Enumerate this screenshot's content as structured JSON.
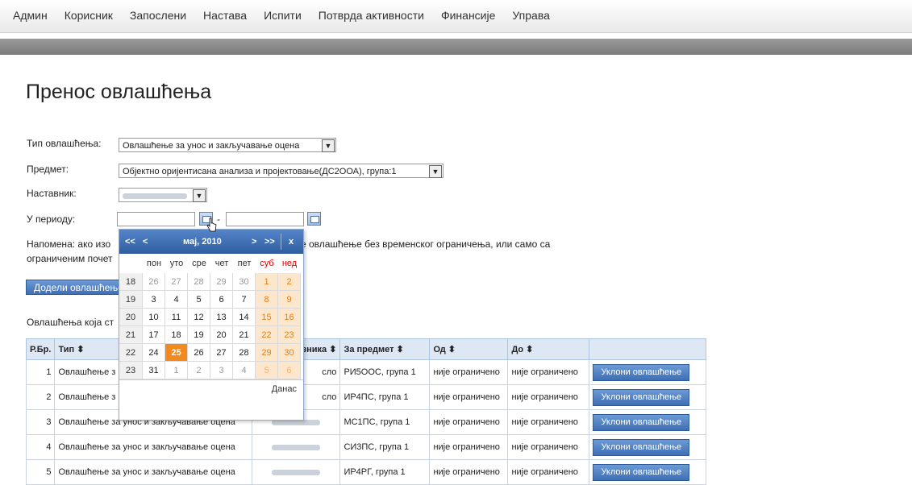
{
  "nav": [
    "Админ",
    "Корисник",
    "Запослени",
    "Настава",
    "Испити",
    "Потврда активности",
    "Финансије",
    "Управа"
  ],
  "page_title": "Пренос овлашћења",
  "form": {
    "type_label": "Тип овлашћења:",
    "type_value": "Овлашћење за унос и закључавање оцена",
    "subject_label": "Предмет:",
    "subject_value": "Објектно оријентисана анализа и пројектовање(ДС2ООА), група:1",
    "teacher_label": "Наставник:",
    "period_label": "У периоду:",
    "period_sep": "-"
  },
  "note": {
    "part1": "Напомена: ако изо",
    "part2": "доделите овлашћење без временског ограничења, или само са",
    "part3": "ограниченим почет"
  },
  "assign_button": "Додели овлашћење",
  "list_title": "Овлашћења која ст",
  "calendar": {
    "prev_year": "<<",
    "prev_month": "<",
    "month_label": "мај, 2010",
    "next_month": ">",
    "next_year": ">>",
    "close": "x",
    "weekdays": [
      "пон",
      "уто",
      "сре",
      "чет",
      "пет",
      "суб",
      "нед"
    ],
    "weeks": [
      {
        "wk": "18",
        "days": [
          "26",
          "27",
          "28",
          "29",
          "30",
          "1",
          "2"
        ]
      },
      {
        "wk": "19",
        "days": [
          "3",
          "4",
          "5",
          "6",
          "7",
          "8",
          "9"
        ]
      },
      {
        "wk": "20",
        "days": [
          "10",
          "11",
          "12",
          "13",
          "14",
          "15",
          "16"
        ]
      },
      {
        "wk": "21",
        "days": [
          "17",
          "18",
          "19",
          "20",
          "21",
          "22",
          "23"
        ]
      },
      {
        "wk": "22",
        "days": [
          "24",
          "25",
          "26",
          "27",
          "28",
          "29",
          "30"
        ]
      },
      {
        "wk": "23",
        "days": [
          "31",
          "1",
          "2",
          "3",
          "4",
          "5",
          "6"
        ]
      }
    ],
    "today_label": "Данас"
  },
  "table": {
    "headers": {
      "no": "Р.Бр.",
      "type": "Тип ⬍",
      "teacher": "зника ⬍",
      "subject": "За предмет ⬍",
      "from": "Од ⬍",
      "to": "До ⬍"
    },
    "rows": [
      {
        "no": "1",
        "type": "Овлашћење з",
        "teacher": "сло",
        "subject": "РИ5ООС, група 1",
        "from": "није ограничено",
        "to": "није ограничено",
        "action": "Уклони овлашћење"
      },
      {
        "no": "2",
        "type": "Овлашћење з",
        "teacher": "сло",
        "subject": "ИР4ПС, група 1",
        "from": "није ограничено",
        "to": "није ограничено",
        "action": "Уклони овлашћење"
      },
      {
        "no": "3",
        "type": "Овлашћење за унос и закључавање оцена",
        "teacher": "",
        "subject": "МС1ПС, група 1",
        "from": "није ограничено",
        "to": "није ограничено",
        "action": "Уклони овлашћење"
      },
      {
        "no": "4",
        "type": "Овлашћење за унос и закључавање оцена",
        "teacher": "",
        "subject": "СИ3ПС, група 1",
        "from": "није ограничено",
        "to": "није ограничено",
        "action": "Уклони овлашћење"
      },
      {
        "no": "5",
        "type": "Овлашћење за унос и закључавање оцена",
        "teacher": "",
        "subject": "ИР4РГ, група 1",
        "from": "није ограничено",
        "to": "није ограничено",
        "action": "Уклони овлашћење"
      }
    ]
  }
}
